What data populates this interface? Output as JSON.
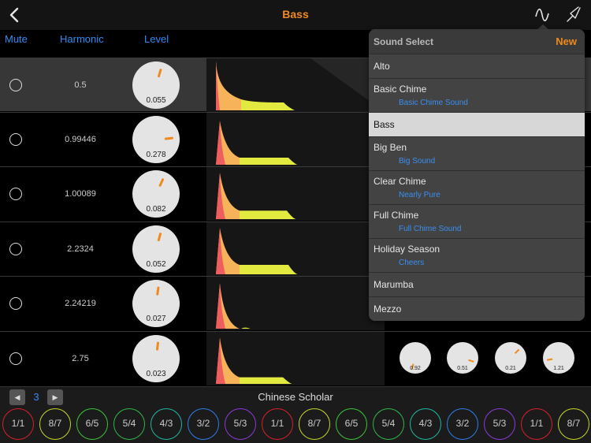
{
  "header": {
    "title": "Bass"
  },
  "columns": {
    "mute": "Mute",
    "harmonic": "Harmonic",
    "level": "Level"
  },
  "rows": [
    {
      "harmonic": "0.5",
      "level": "0.055",
      "level_value": 0.055,
      "selected": true
    },
    {
      "harmonic": "0.99446",
      "level": "0.278",
      "level_value": 0.278,
      "selected": false
    },
    {
      "harmonic": "1.00089",
      "level": "0.082",
      "level_value": 0.082,
      "selected": false
    },
    {
      "harmonic": "2.2324",
      "level": "0.052",
      "level_value": 0.052,
      "selected": false
    },
    {
      "harmonic": "2.24219",
      "level": "0.027",
      "level_value": 0.027,
      "selected": false
    },
    {
      "harmonic": "2.75",
      "level": "0.023",
      "level_value": 0.023,
      "selected": false
    }
  ],
  "small_knobs": [
    {
      "label": "0.92",
      "value": 0.92
    },
    {
      "label": "0.51",
      "value": 0.51
    },
    {
      "label": "0.21",
      "value": 0.21
    },
    {
      "label": "1.21",
      "value": 1.21
    }
  ],
  "sound_select": {
    "title": "Sound Select",
    "new_label": "New",
    "items": [
      {
        "name": "Alto",
        "sub": "",
        "active": false
      },
      {
        "name": "Basic Chime",
        "sub": "Basic Chime Sound",
        "active": false
      },
      {
        "name": "Bass",
        "sub": "",
        "active": true
      },
      {
        "name": "Big Ben",
        "sub": "Big Sound",
        "active": false
      },
      {
        "name": "Clear Chime",
        "sub": "Nearly Pure",
        "active": false
      },
      {
        "name": "Full Chime",
        "sub": "Full Chime Sound",
        "active": false
      },
      {
        "name": "Holiday Season",
        "sub": "Cheers",
        "active": false
      },
      {
        "name": "Marumba",
        "sub": "",
        "active": false
      },
      {
        "name": "Mezzo",
        "sub": "",
        "active": false
      }
    ]
  },
  "bottom": {
    "page": "3",
    "prev_label": "◀",
    "next_label": "▶",
    "scale_name": "Chinese Scholar",
    "ratios": [
      {
        "label": "1/1",
        "color": "#d8202a"
      },
      {
        "label": "8/7",
        "color": "#c8d62a"
      },
      {
        "label": "6/5",
        "color": "#3ec43a"
      },
      {
        "label": "5/4",
        "color": "#2fb84a"
      },
      {
        "label": "4/3",
        "color": "#1fb8a0"
      },
      {
        "label": "3/2",
        "color": "#2f7ee8"
      },
      {
        "label": "5/3",
        "color": "#8b3ad8"
      },
      {
        "label": "1/1",
        "color": "#d8202a"
      },
      {
        "label": "8/7",
        "color": "#c8d62a"
      },
      {
        "label": "6/5",
        "color": "#3ec43a"
      },
      {
        "label": "5/4",
        "color": "#2fb84a"
      },
      {
        "label": "4/3",
        "color": "#1fb8a0"
      },
      {
        "label": "3/2",
        "color": "#2f7ee8"
      },
      {
        "label": "5/3",
        "color": "#8b3ad8"
      },
      {
        "label": "1/1",
        "color": "#d8202a"
      },
      {
        "label": "8/7",
        "color": "#c8d62a"
      }
    ]
  },
  "colors": {
    "accent": "#f08a1c",
    "link": "#2f8cf5",
    "env_attack": "#ee5e5e",
    "env_decay": "#f7b35a",
    "env_sustain": "#e2ea40"
  }
}
